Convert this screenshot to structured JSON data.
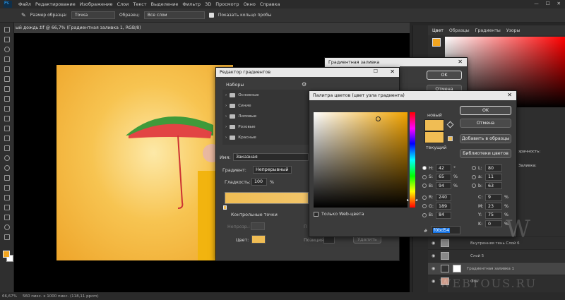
{
  "menu": [
    "Файл",
    "Редактирование",
    "Изображение",
    "Слои",
    "Текст",
    "Выделение",
    "Фильтр",
    "3D",
    "Просмотр",
    "Окно",
    "Справка"
  ],
  "options": {
    "sample_size_label": "Размер образца:",
    "sample_size_value": "Точка",
    "sample_label": "Образец:",
    "sample_value": "Все слои",
    "show_ring_label": "Показать кольцо пробы"
  },
  "document": {
    "tab_title": "ый дождь.tif @ 66,7% (Градиентная заливка 1, RGB/8)"
  },
  "status": {
    "zoom": "66,67%",
    "info": "560 пикс. x 1000 пикс. (118,11 ppcm)"
  },
  "panel_tabs": [
    "Цвет",
    "Образцы",
    "Градиенты",
    "Узоры"
  ],
  "gradient_fill": {
    "title": "Градиентная заливка",
    "ok": "OK",
    "cancel": "Отмена"
  },
  "gradient_editor": {
    "title": "Редактор градиентов",
    "presets_label": "Наборы",
    "folders": [
      "Основные",
      "Синие",
      "Лиловые",
      "Розовые",
      "Красные"
    ],
    "name_label": "Имя:",
    "name_value": "Заказная",
    "type_label": "Градиент:",
    "type_value": "Непрерывный",
    "smooth_label": "Гладкость:",
    "smooth_value": "100",
    "smooth_unit": "%",
    "stops_title": "Контрольные точки",
    "opacity_label": "Непрозр.:",
    "color_label": "Цвет:",
    "position_label": "Позиция:",
    "delete_label": "Удалить",
    "letter_p": "П"
  },
  "color_picker": {
    "title": "Палитра цветов (цвет узла градиента)",
    "new_label": "новый",
    "current_label": "текущий",
    "ok": "OK",
    "cancel": "Отмена",
    "add_swatch": "Добавить в образцы",
    "libraries": "Библиотеки цветов",
    "web_only": "Только Web-цвета",
    "fields": [
      {
        "k": "H:",
        "v": "42",
        "u": "°"
      },
      {
        "k": "S:",
        "v": "65",
        "u": "%"
      },
      {
        "k": "B:",
        "v": "94",
        "u": "%"
      },
      {
        "k": "R:",
        "v": "240",
        "u": ""
      },
      {
        "k": "G:",
        "v": "189",
        "u": ""
      },
      {
        "k": "B:",
        "v": "84",
        "u": ""
      }
    ],
    "lab_fields": [
      {
        "k": "L:",
        "v": "80",
        "u": ""
      },
      {
        "k": "a:",
        "v": "11",
        "u": ""
      },
      {
        "k": "b:",
        "v": "63",
        "u": ""
      },
      {
        "k": "C:",
        "v": "9",
        "u": "%"
      },
      {
        "k": "M:",
        "v": "23",
        "u": "%"
      },
      {
        "k": "Y:",
        "v": "75",
        "u": "%"
      },
      {
        "k": "K:",
        "v": "0",
        "u": "%"
      }
    ],
    "hex": "f0bd54",
    "colors": {
      "new": "#f0bd54",
      "current": "#f0bd54"
    }
  },
  "layers": {
    "opacity_label": "зрачность:",
    "fill_label": "Заливка:",
    "rows": [
      "Внутренняя тень Слой 6",
      "Слой 5",
      "Градиентная заливка 1",
      "Фон"
    ]
  },
  "watermark": {
    "letter": "W",
    "site": "WEBTOUS.RU"
  },
  "colors": {
    "foreground": "#f2a51f",
    "accent": "#f0bd54"
  }
}
